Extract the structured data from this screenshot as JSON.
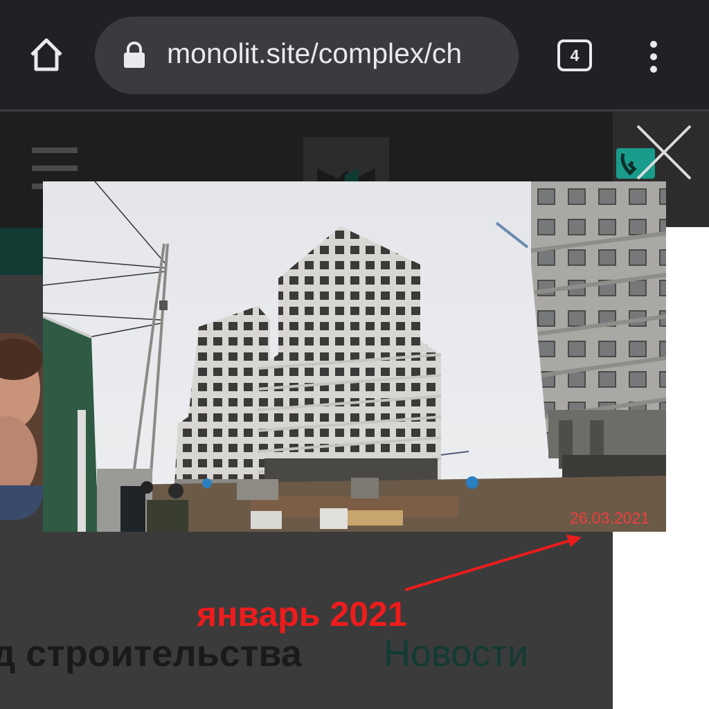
{
  "browser": {
    "url": "monolit.site/complex/ch",
    "tab_count": "4",
    "icons": {
      "home": "home-icon",
      "lock": "lock-icon",
      "menu": "more-vert-icon"
    }
  },
  "page": {
    "nav_left": "д строительства",
    "nav_right": "Новости"
  },
  "photo": {
    "date_stamp": "26.03.2021"
  },
  "annotation": {
    "text": "январь 2021",
    "color": "#ee1c1c"
  },
  "colors": {
    "brand_teal": "#123b33",
    "accent_teal": "#1a9c8c"
  }
}
